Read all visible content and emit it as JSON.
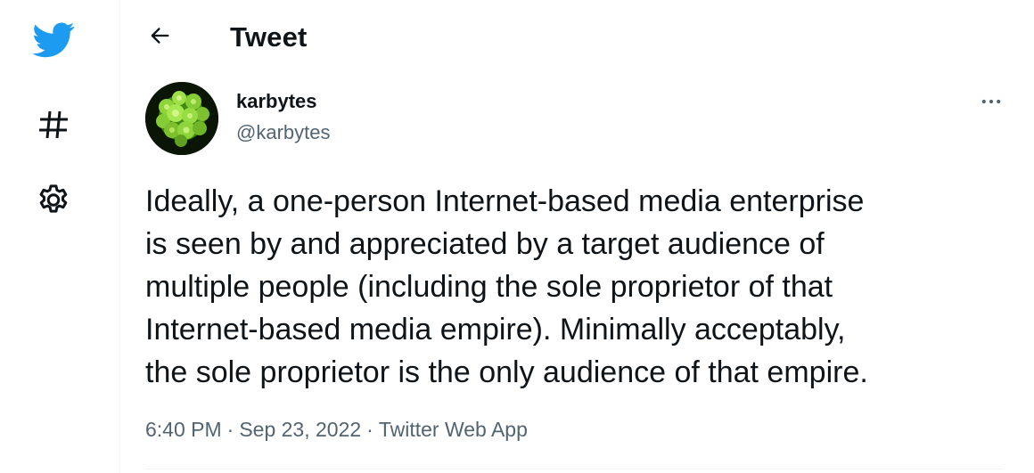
{
  "nav": {
    "items": [
      {
        "name": "twitter-logo",
        "icon": "twitter-bird-icon",
        "color": "#1d9bf0"
      },
      {
        "name": "explore",
        "icon": "hashtag-icon"
      },
      {
        "name": "settings",
        "icon": "gear-icon"
      }
    ]
  },
  "header": {
    "back_icon": "arrow-left-icon",
    "title": "Tweet"
  },
  "tweet": {
    "author": {
      "display_name": "karbytes",
      "handle": "@karbytes",
      "avatar": "green fractal cauliflower image"
    },
    "more_icon": "more-horizontal-icon",
    "text": "Ideally, a one-person Internet-based media enterprise\nis seen by and appreciated by a target audience of\nmultiple people (including the sole proprietor of that\nInternet-based media empire). Minimally acceptably,\nthe sole proprietor is the only audience of that empire.",
    "time": "6:40 PM",
    "date": "Sep 23, 2022",
    "separator": "·",
    "source": "Twitter Web App"
  },
  "colors": {
    "brand": "#1d9bf0",
    "text_primary": "#0f1419",
    "text_secondary": "#536471",
    "border": "#eff3f4"
  }
}
